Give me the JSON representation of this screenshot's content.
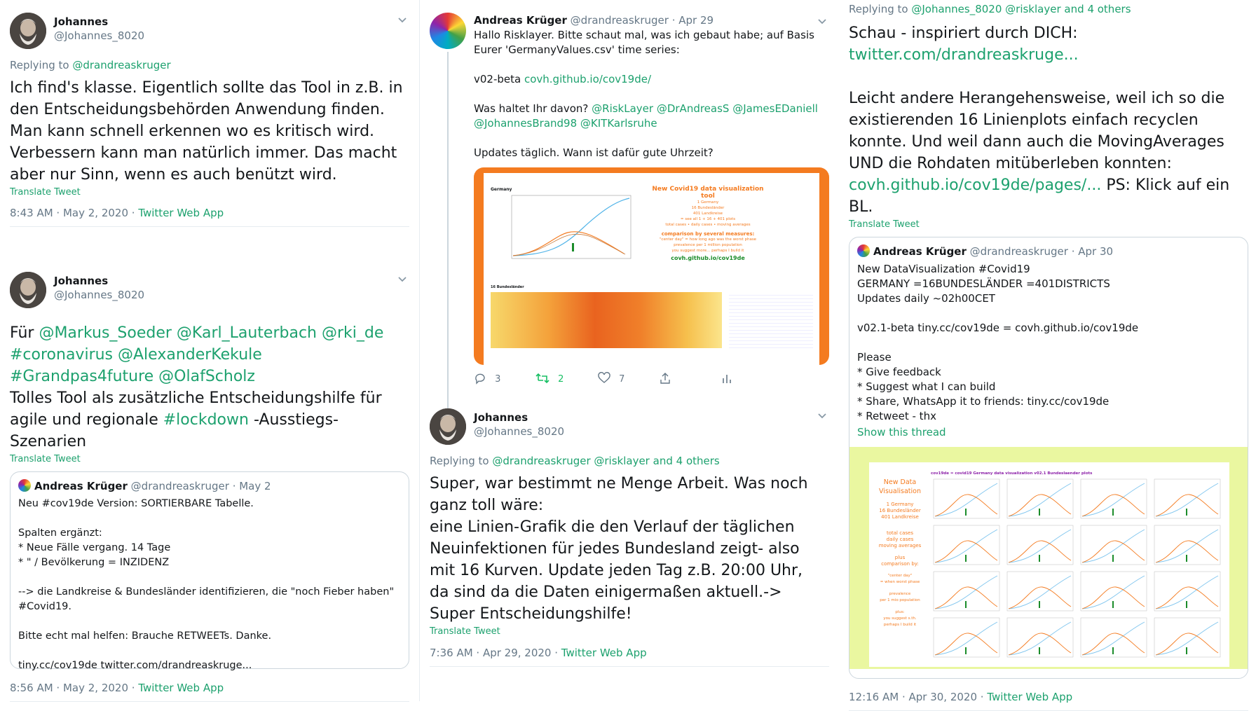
{
  "col1": {
    "tweet1": {
      "name": "Johannes",
      "handle": "@Johannes_8020",
      "reply_prefix": "Replying to",
      "reply_to": "@drandreaskruger",
      "text": "Ich find's klasse. Eigentlich sollte das Tool in z.B. in den Entscheidungsbehörden Anwendung finden. Man kann schnell erkennen wo es kritisch wird. Verbessern kann man natürlich immer. Das macht aber nur Sinn, wenn es auch benützt wird.",
      "translate": "Translate Tweet",
      "time": "8:43 AM · May 2, 2020",
      "source": "Twitter Web App"
    },
    "tweet2": {
      "name": "Johannes",
      "handle": "@Johannes_8020",
      "t_pre": "Für",
      "mentions1": "@Markus_Soeder @Karl_Lauterbach @rki_de #coronavirus @AlexanderKekule #Grandpas4future @OlafScholz",
      "t_mid": "Tolles Tool als zusätzliche Entscheidungshilfe für agile und regionale",
      "hashtag": "#lockdown",
      "t_post": "-Ausstiegs-Szenarien",
      "translate": "Translate Tweet",
      "quote": {
        "name": "Andreas Krüger",
        "handle": "@drandreaskruger · May 2",
        "l1": "Neu #cov19de Version: SORTIERBARE Tabelle.",
        "l2": "Spalten ergänzt:",
        "l3": "* Neue Fälle vergang. 14 Tage",
        "l4": "* \" / Bevölkerung = INZIDENZ",
        "l5": "--> die Landkreise & Bundesländer identifizieren, die \"noch Fieber haben\" #Covid19.",
        "l6": "Bitte echt mal helfen: Brauche RETWEETs. Danke.",
        "l7": "tiny.cc/cov19de twitter.com/drandreaskruge..."
      },
      "time": "8:56 AM · May 2, 2020",
      "source": "Twitter Web App"
    }
  },
  "col2": {
    "tweet1": {
      "name": "Andreas Krüger",
      "handle": "@drandreaskruger · Apr 29",
      "l1": "Hallo Risklayer. Bitte schaut mal, was ich gebaut habe; auf Basis Eurer 'GermanyValues.csv' time series:",
      "l2a": "v02-beta",
      "l2b": "covh.github.io/cov19de/",
      "l3a": "Was haltet Ihr davon?",
      "l3b": "@RiskLayer @DrAndreasS @JamesEDaniell @JohannesBrand98 @KITKarlsruhe",
      "l4": "Updates täglich. Wann ist dafür gute Uhrzeit?",
      "img_title": "New Covid19 data visualization tool",
      "img_lines": [
        "1 Germany",
        "16 Bundesländer",
        "401 Landkreise",
        "= see all 1 + 16 + 401 plots",
        "total cases • daily cases • moving averages"
      ],
      "img_cmp": "comparison by several measures:",
      "img_cmp_lines": [
        "\"center day\" = how long ago was the worst phase",
        "prevalence per 1 million population",
        "you suggest more... perhaps I build it"
      ],
      "img_link": "covh.github.io/cov19de",
      "img_germany": "Germany",
      "img_bl": "16 Bundesländer",
      "replies": "3",
      "retweets": "2",
      "likes": "7"
    },
    "tweet2": {
      "name": "Johannes",
      "handle": "@Johannes_8020",
      "reply_prefix": "Replying to",
      "reply_to": "@drandreaskruger @risklayer",
      "reply_and": "and",
      "reply_others": "4 others",
      "text": "Super, war bestimmt ne Menge Arbeit. Was noch ganz toll wäre:\neine Linien-Grafik die den Verlauf der täglichen Neuinfektionen für jedes Bundesland zeigt- also mit 16 Kurven. Update jeden Tag z.B. 20:00 Uhr, da sind da die Daten einigermaßen aktuell.-> Super Entscheidungshilfe!",
      "translate": "Translate Tweet",
      "time": "7:36 AM · Apr 29, 2020",
      "source": "Twitter Web App"
    }
  },
  "col3": {
    "reply_prefix": "Replying to",
    "reply_to": "@Johannes_8020 @risklayer",
    "reply_and": "and",
    "reply_others": "4 others",
    "t1": "Schau - inspiriert durch DICH:",
    "t1link": "twitter.com/drandreaskruge...",
    "t2": "Leicht andere Herangehensweise, weil ich so die existierenden 16 Linienplots einfach recyclen konnte. Und weil dann auch die MovingAverages UND die Rohdaten mitüberleben konnten:",
    "t3link": "covh.github.io/cov19de/pages/...",
    "t3": "PS: Klick auf ein BL.",
    "translate": "Translate Tweet",
    "quote": {
      "name": "Andreas Krüger",
      "handle": "@drandreaskruger · Apr 30",
      "l1": "New DataVisualization #Covid19",
      "l2": "GERMANY =16BUNDESLÄNDER =401DISTRICTS",
      "l3": "Updates daily ~02h00CET",
      "l4": "v02.1-beta tiny.cc/cov19de = covh.github.io/cov19de",
      "l5": "Please",
      "l6": "* Give feedback",
      "l7": "* Suggest what I can build",
      "l8": "* Share, WhatsApp it to friends: tiny.cc/cov19de",
      "l9": "* Retweet - thx",
      "show": "Show this thread",
      "img_side": [
        "New Data",
        "Visualisation",
        "1 Germany",
        "16 Bundesländer",
        "401 Landkreise",
        "total cases",
        "daily cases",
        "moving averages",
        "plus",
        "comparison by:",
        "\"center day\"",
        "= when worst phase",
        "prevalence",
        "per 1 mio population",
        "plus:",
        "you suggest s.th.",
        "perhaps I build it"
      ],
      "img_header": "cov19de = covid19 Germany data visualization v02.1 Bundeslaender plots"
    },
    "time": "12:16 AM · Apr 30, 2020",
    "source": "Twitter Web App"
  },
  "colors": {
    "link": "#1da16e",
    "orange": "#f47b20",
    "lime": "#eaf7a0"
  }
}
